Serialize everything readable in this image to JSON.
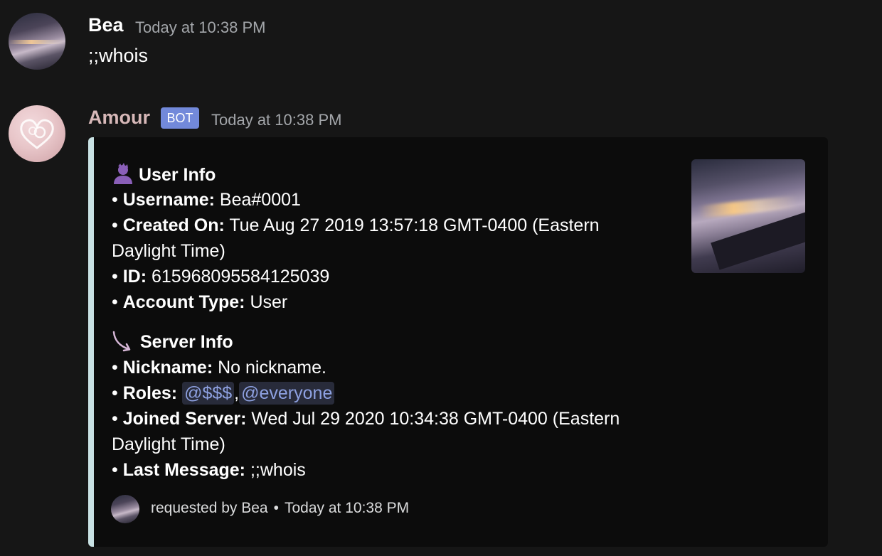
{
  "messages": [
    {
      "author": "Bea",
      "timestamp": "Today at 10:38 PM",
      "content": ";;whois"
    },
    {
      "author": "Amour",
      "badge": "BOT",
      "timestamp": "Today at 10:38 PM",
      "author_color": "#d7b8b8"
    }
  ],
  "embed": {
    "bar_color": "#c9e2e4",
    "user_info": {
      "icon": "purple-person-icon",
      "title": "User Info",
      "fields": [
        {
          "label": "Username:",
          "value": "Bea#0001"
        },
        {
          "label": "Created On:",
          "value": "Tue Aug 27 2019 13:57:18 GMT-0400 (Eastern",
          "value_cont": "Daylight Time)"
        },
        {
          "label": "ID:",
          "value": "615968095584125039"
        },
        {
          "label": "Account Type:",
          "value": "User"
        }
      ]
    },
    "server_info": {
      "icon": "curved-arrow-icon",
      "title": "Server Info",
      "fields": [
        {
          "label": "Nickname:",
          "value": "No nickname."
        },
        {
          "label": "Roles:",
          "roles": [
            "@$$$",
            "@everyone"
          ],
          "separator": ","
        },
        {
          "label": "Joined Server:",
          "value": "Wed Jul 29 2020 10:34:38 GMT-0400 (Eastern",
          "value_cont": "Daylight Time)"
        },
        {
          "label": "Last Message:",
          "value": ";;whois"
        }
      ]
    },
    "footer": {
      "text": "requested by Bea",
      "separator": "•",
      "timestamp": "Today at 10:38 PM"
    },
    "bullet": "•"
  },
  "colors": {
    "background": "#161616",
    "embed_background": "#0c0c0c",
    "bot_badge": "#7289da",
    "mention": "#8ea1e1"
  }
}
